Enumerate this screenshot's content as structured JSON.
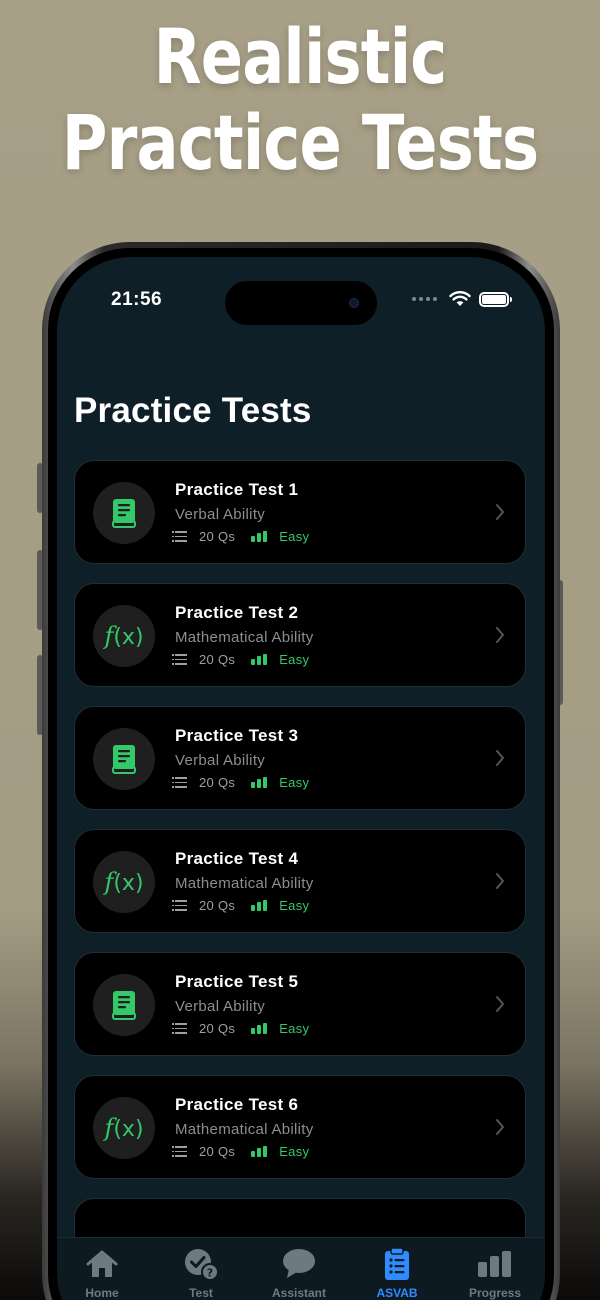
{
  "headline": {
    "line1": "Realistic",
    "line2": "Practice Tests"
  },
  "status_bar": {
    "time": "21:56"
  },
  "page": {
    "title": "Practice Tests"
  },
  "tests": [
    {
      "title": "Practice Test 1",
      "subject": "Verbal Ability",
      "questions": "20 Qs",
      "difficulty": "Easy",
      "icon": "book-icon"
    },
    {
      "title": "Practice Test 2",
      "subject": "Mathematical Ability",
      "questions": "20 Qs",
      "difficulty": "Easy",
      "icon": "function-icon"
    },
    {
      "title": "Practice Test 3",
      "subject": "Verbal Ability",
      "questions": "20 Qs",
      "difficulty": "Easy",
      "icon": "book-icon"
    },
    {
      "title": "Practice Test 4",
      "subject": "Mathematical Ability",
      "questions": "20 Qs",
      "difficulty": "Easy",
      "icon": "function-icon"
    },
    {
      "title": "Practice Test 5",
      "subject": "Verbal Ability",
      "questions": "20 Qs",
      "difficulty": "Easy",
      "icon": "book-icon"
    },
    {
      "title": "Practice Test 6",
      "subject": "Mathematical Ability",
      "questions": "20 Qs",
      "difficulty": "Easy",
      "icon": "function-icon"
    }
  ],
  "function_icon_text": {
    "f": "f",
    "x": "(x)"
  },
  "tabbar": {
    "tabs": [
      {
        "label": "Home",
        "icon": "home-icon",
        "active": false
      },
      {
        "label": "Test",
        "icon": "test-check-icon",
        "active": false
      },
      {
        "label": "Assistant",
        "icon": "chat-bubble-icon",
        "active": false
      },
      {
        "label": "ASVAB",
        "icon": "clipboard-list-icon",
        "active": true
      },
      {
        "label": "Progress",
        "icon": "bar-chart-icon",
        "active": false
      }
    ]
  },
  "colors": {
    "accent_green": "#33c86a",
    "active_blue": "#2f8cff",
    "screen_bg": "#0f1f28",
    "card_bg": "#000000"
  }
}
